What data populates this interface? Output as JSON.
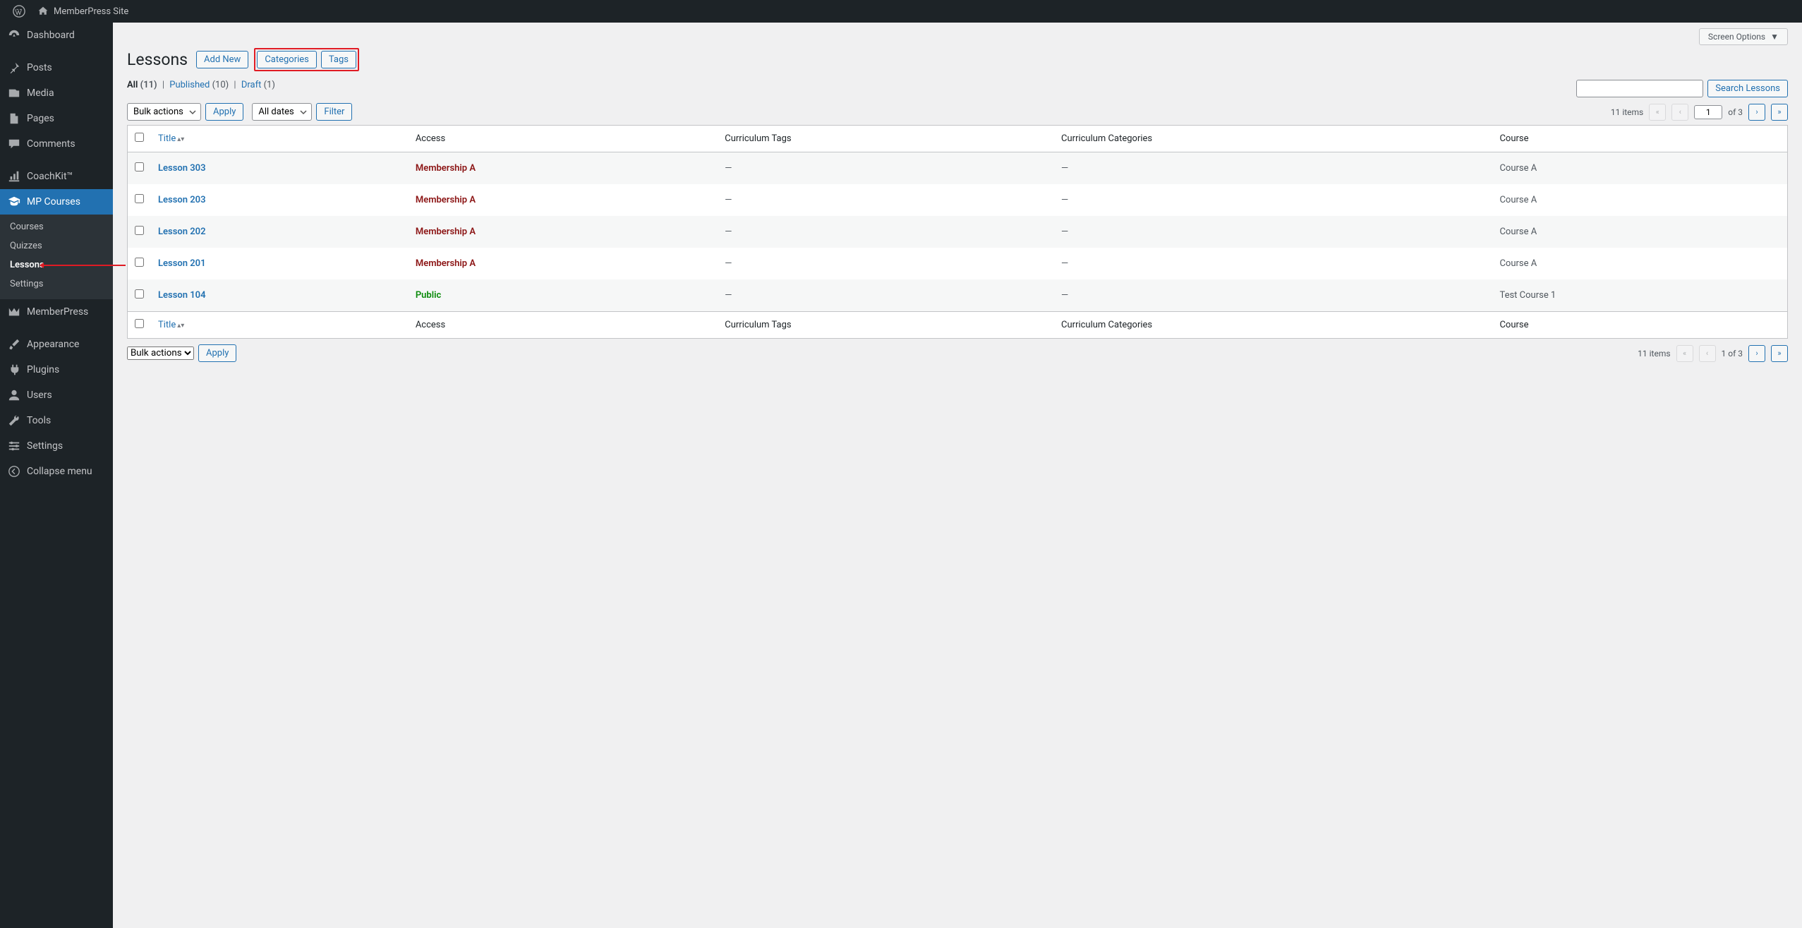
{
  "adminBar": {
    "siteName": "MemberPress Site"
  },
  "sidebar": {
    "items": [
      {
        "label": "Dashboard",
        "icon": "dashboard"
      },
      {
        "label": "Posts",
        "icon": "pin"
      },
      {
        "label": "Media",
        "icon": "media"
      },
      {
        "label": "Pages",
        "icon": "pages"
      },
      {
        "label": "Comments",
        "icon": "comments"
      },
      {
        "label": "CoachKit™",
        "icon": "chart"
      },
      {
        "label": "MP Courses",
        "icon": "graduation"
      },
      {
        "label": "MemberPress",
        "icon": "mp"
      },
      {
        "label": "Appearance",
        "icon": "brush"
      },
      {
        "label": "Plugins",
        "icon": "plug"
      },
      {
        "label": "Users",
        "icon": "user"
      },
      {
        "label": "Tools",
        "icon": "wrench"
      },
      {
        "label": "Settings",
        "icon": "gear"
      },
      {
        "label": "Collapse menu",
        "icon": "collapse"
      }
    ],
    "submenu": [
      "Courses",
      "Quizzes",
      "Lessons",
      "Settings"
    ]
  },
  "screenOptions": "Screen Options",
  "page": {
    "title": "Lessons",
    "actions": {
      "addNew": "Add New",
      "categories": "Categories",
      "tags": "Tags"
    }
  },
  "views": {
    "all": {
      "label": "All",
      "count": "(11)"
    },
    "published": {
      "label": "Published",
      "count": "(10)"
    },
    "draft": {
      "label": "Draft",
      "count": "(1)"
    },
    "sep": "|"
  },
  "filters": {
    "bulkActions": "Bulk actions",
    "apply": "Apply",
    "allDates": "All dates",
    "filter": "Filter"
  },
  "search": {
    "button": "Search Lessons"
  },
  "pagination": {
    "items": "11 items",
    "page": "1",
    "of": "of 3",
    "bottomOf": "1 of 3"
  },
  "columns": {
    "title": "Title",
    "access": "Access",
    "curriculumTags": "Curriculum Tags",
    "curriculumCategories": "Curriculum Categories",
    "course": "Course"
  },
  "rows": [
    {
      "title": "Lesson 303",
      "access": "Membership A",
      "accessType": "membership",
      "tags": "—",
      "cats": "—",
      "course": "Course A"
    },
    {
      "title": "Lesson 203",
      "access": "Membership A",
      "accessType": "membership",
      "tags": "—",
      "cats": "—",
      "course": "Course A"
    },
    {
      "title": "Lesson 202",
      "access": "Membership A",
      "accessType": "membership",
      "tags": "—",
      "cats": "—",
      "course": "Course A"
    },
    {
      "title": "Lesson 201",
      "access": "Membership A",
      "accessType": "membership",
      "tags": "—",
      "cats": "—",
      "course": "Course A"
    },
    {
      "title": "Lesson 104",
      "access": "Public",
      "accessType": "public",
      "tags": "—",
      "cats": "—",
      "course": "Test Course 1"
    }
  ]
}
